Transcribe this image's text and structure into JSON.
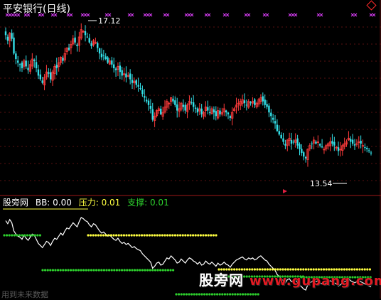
{
  "window": {
    "title": "平安银行(日线)"
  },
  "main_chart": {
    "high_label": "17.12",
    "low_label": "13.54",
    "ylim": [
      12.6,
      17.7
    ]
  },
  "indicator_panel": {
    "name": "股旁网",
    "bb_label": "BB: 0.00",
    "pressure_label": "压力: 0.01",
    "support_label": "支撑: 0.01"
  },
  "footer": {
    "future_data_notice": "用到未来数据"
  },
  "watermark": {
    "brand": "股旁网",
    "domain": "www.gupang.com"
  },
  "colors": {
    "up_candle": "#ff3b3b",
    "down_candle": "#33e0e8",
    "pressure_dots": "#ffff40",
    "support_dots": "#2dd02d",
    "line": "#ffffff",
    "signal_x": "#e040ff",
    "separator": "#a01818"
  },
  "chart_data": {
    "type": "line",
    "x": [
      0,
      1,
      2,
      3,
      4,
      5,
      6,
      7,
      8,
      9,
      10,
      11,
      12,
      13,
      14,
      15,
      16,
      17,
      18,
      19,
      20,
      21,
      22,
      23,
      24,
      25,
      26,
      27,
      28,
      29,
      30,
      31,
      32,
      33,
      34,
      35,
      36,
      37,
      38,
      39,
      40,
      41,
      42,
      43,
      44,
      45,
      46,
      47,
      48,
      49,
      50,
      51,
      52,
      53,
      54,
      55,
      56,
      57,
      58,
      59,
      60,
      61,
      62,
      63,
      64,
      65,
      66,
      67,
      68,
      69,
      70,
      71,
      72,
      73,
      74,
      75,
      76,
      77,
      78,
      79,
      80,
      81,
      82,
      83,
      84,
      85,
      86,
      87,
      88,
      89,
      90,
      91,
      92,
      93,
      94,
      95,
      96,
      97,
      98,
      99,
      100,
      101,
      102,
      103,
      104,
      105,
      106,
      107,
      108,
      109,
      110,
      111,
      112,
      113,
      114,
      115,
      116,
      117,
      118,
      119,
      120,
      121,
      122,
      123,
      124,
      125,
      126,
      127,
      128,
      129,
      130,
      131,
      132,
      133,
      134,
      135,
      136,
      137,
      138,
      139,
      140,
      141,
      142,
      143,
      144,
      145,
      146,
      147,
      148,
      149,
      150,
      151,
      152,
      153,
      154,
      155,
      156,
      157,
      158,
      159,
      160,
      161,
      162,
      163,
      164,
      165,
      166,
      167,
      168,
      169,
      170,
      171,
      172,
      173,
      174,
      175,
      176
    ],
    "series": [
      {
        "values": [
          16.9,
          16.75,
          16.95,
          16.8,
          16.4,
          16.25,
          16.15,
          16.1,
          16,
          16.2,
          16.05,
          15.95,
          16.1,
          16.25,
          16.2,
          16,
          15.8,
          15.7,
          15.6,
          15.75,
          15.9,
          15.85,
          15.7,
          15.9,
          16.05,
          16,
          16.15,
          16.3,
          16.2,
          16.4,
          16.55,
          16.5,
          16.65,
          16.8,
          16.7,
          16.6,
          16.85,
          17.05,
          17,
          16.9,
          16.85,
          16.7,
          16.6,
          16.75,
          16.7,
          16.55,
          16.4,
          16.3,
          16.35,
          16.25,
          16.15,
          16.2,
          16.1,
          16,
          15.95,
          16.05,
          15.9,
          15.8,
          15.85,
          15.75,
          15.8,
          15.7,
          15.6,
          15.65,
          15.55,
          15.5,
          15.45,
          15.3,
          15.2,
          15.1,
          15,
          14.9,
          14.6,
          14.7,
          14.85,
          14.9,
          14.75,
          14.8,
          14.95,
          15.1,
          15.05,
          15.2,
          15.1,
          15,
          14.85,
          14.9,
          15.05,
          14.95,
          14.85,
          15,
          15.1,
          15.05,
          14.95,
          14.9,
          14.8,
          14.9,
          14.75,
          14.8,
          14.95,
          14.85,
          14.8,
          14.9,
          14.8,
          14.7,
          14.85,
          14.75,
          14.8,
          14.9,
          14.8,
          14.75,
          14.65,
          14.8,
          14.9,
          15,
          15.05,
          15.1,
          15.15,
          15.05,
          15,
          15.1,
          15.05,
          15.1,
          15,
          15.05,
          15.15,
          15.2,
          15.1,
          15,
          14.95,
          14.8,
          14.7,
          14.6,
          14.5,
          14.3,
          14.2,
          14.1,
          14,
          13.9,
          14.05,
          14.1,
          13.95,
          14,
          14.05,
          13.9,
          13.8,
          13.7,
          13.6,
          13.55,
          13.8,
          13.9,
          13.95,
          14.05,
          13.95,
          14.0,
          13.9,
          13.85,
          13.8,
          13.9,
          13.95,
          14.0,
          13.95,
          13.9,
          13.85,
          13.75,
          13.8,
          13.9,
          13.95,
          14.0,
          14.1,
          14.0,
          13.95,
          13.9,
          13.95,
          14.0,
          13.95,
          13.9,
          13.85,
          13.8,
          13.75,
          13.7
        ]
      }
    ]
  }
}
